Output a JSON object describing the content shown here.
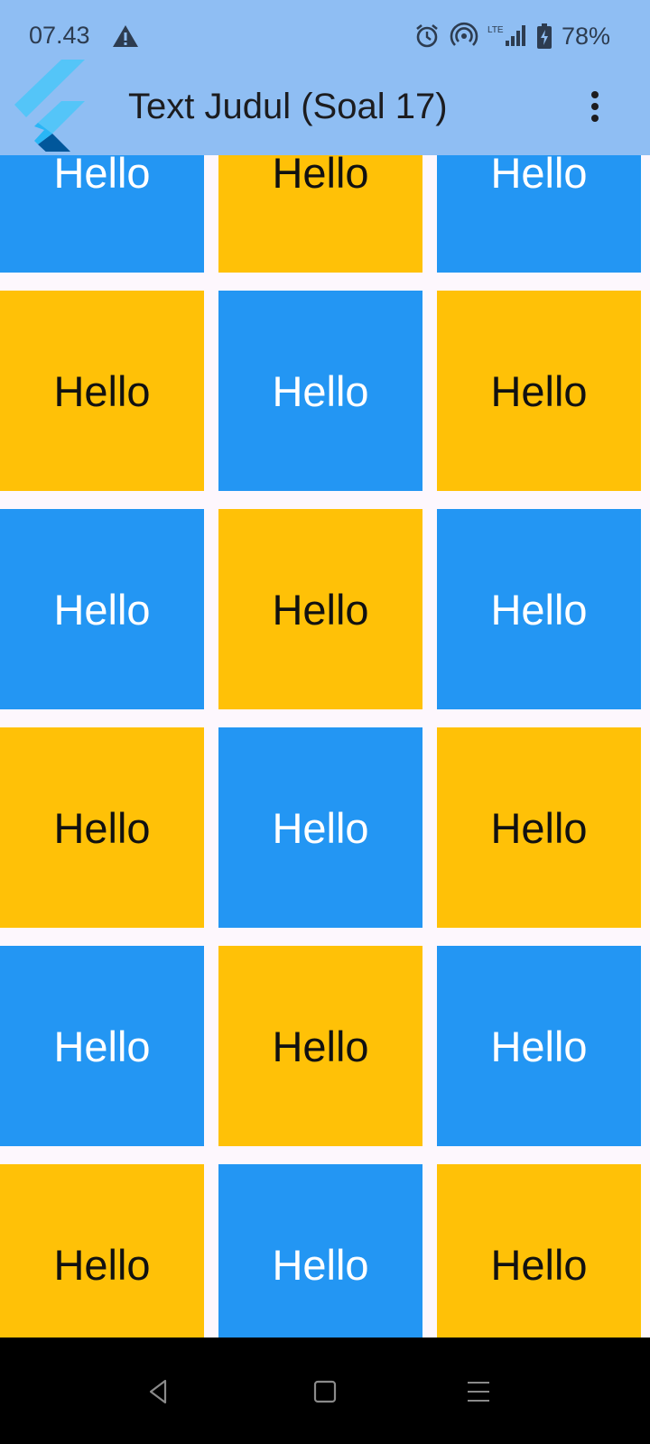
{
  "status_bar": {
    "time": "07.43",
    "battery_percent": "78%",
    "icons": [
      "warning-icon",
      "alarm-icon",
      "hotspot-icon",
      "lte-signal-icon",
      "battery-icon"
    ]
  },
  "app_bar": {
    "title": "Text Judul (Soal 17)",
    "logo": "flutter-logo",
    "menu_icon": "more-vert-icon"
  },
  "grid": {
    "colors": {
      "blue": "#2396f3",
      "amber": "#ffc107"
    },
    "rows": [
      [
        "Hello",
        "Hello",
        "Hello"
      ],
      [
        "Hello",
        "Hello",
        "Hello"
      ],
      [
        "Hello",
        "Hello",
        "Hello"
      ],
      [
        "Hello",
        "Hello",
        "Hello"
      ],
      [
        "Hello",
        "Hello",
        "Hello"
      ],
      [
        "Hello",
        "Hello",
        "Hello"
      ]
    ]
  },
  "nav_bar": {
    "buttons": [
      "back-icon",
      "home-icon",
      "recents-icon"
    ]
  }
}
